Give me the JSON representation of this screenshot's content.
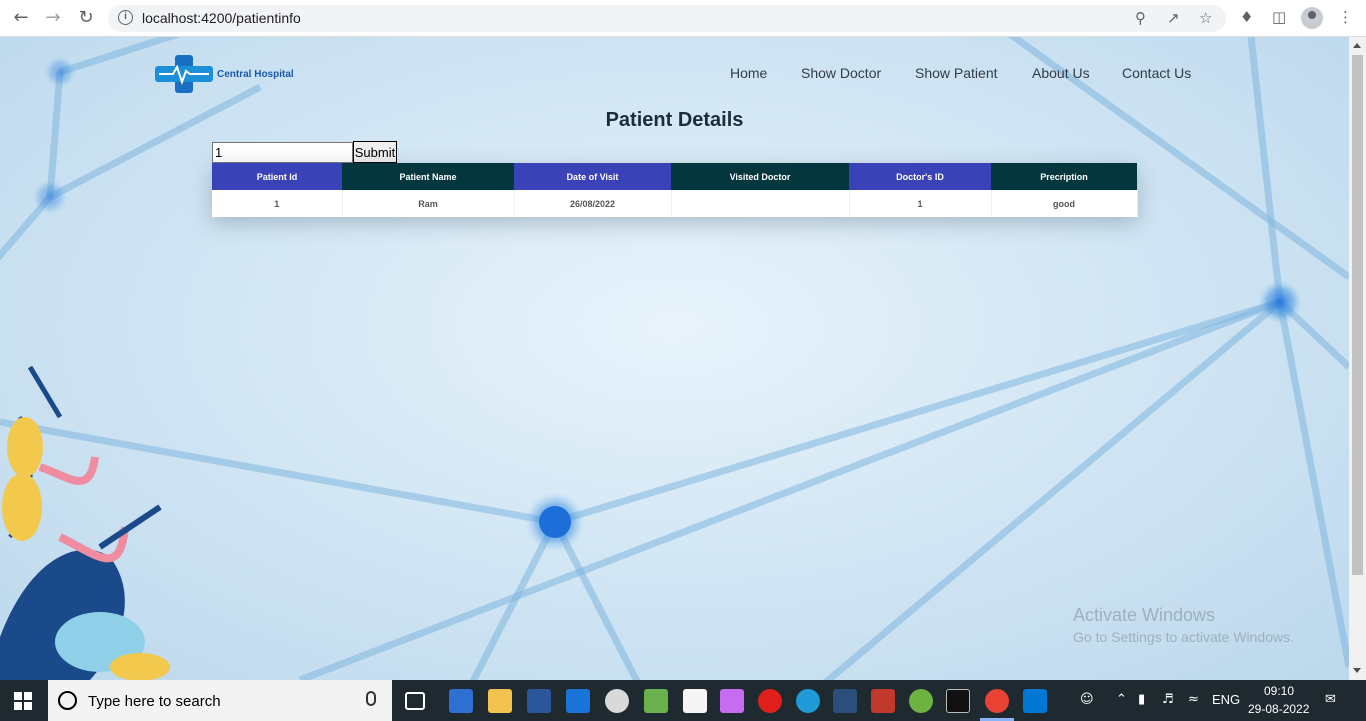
{
  "browser": {
    "url": "localhost:4200/patientinfo",
    "back_icon": "arrow-left-icon",
    "forward_icon": "arrow-right-icon",
    "reload_icon": "reload-icon"
  },
  "header": {
    "logo_text": "Central Hospital",
    "nav": [
      "Home",
      "Show Doctor",
      "Show Patient",
      "About Us",
      "Contact Us"
    ]
  },
  "main": {
    "title": "Patient Details",
    "search_value": "1",
    "submit_label": "Submit",
    "table": {
      "headers": [
        "Patient Id",
        "Patient Name",
        "Date of Visit",
        "Visited Doctor",
        "Doctor's ID",
        "Precription"
      ],
      "rows": [
        [
          "1",
          "Ram",
          "26/08/2022",
          "",
          "1",
          "good"
        ]
      ]
    }
  },
  "watermark": {
    "line1": "Activate Windows",
    "line2": "Go to Settings to activate Windows."
  },
  "taskbar": {
    "search_placeholder": "Type here to search",
    "language": "ENG",
    "time": "09:10",
    "date": "29-08-2022"
  },
  "colors": {
    "table_header_blue": "#3a42b8",
    "table_header_dark": "#04363d",
    "logo_blue": "#1a5aa8"
  }
}
